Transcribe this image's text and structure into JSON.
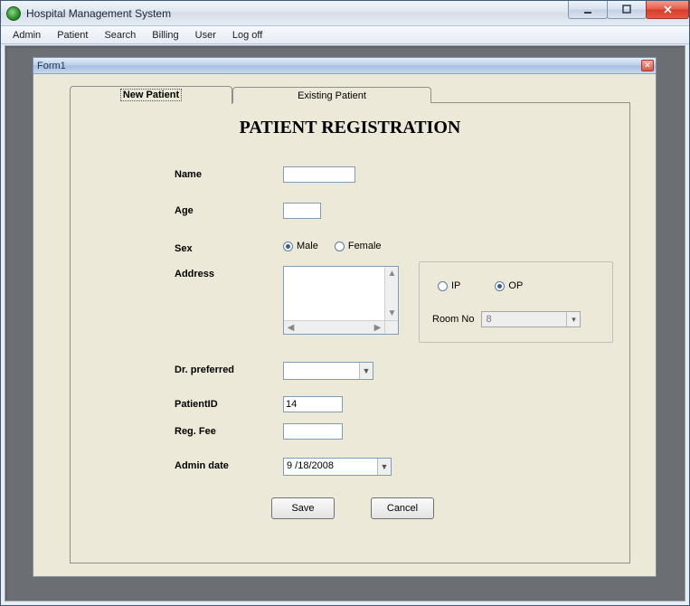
{
  "window": {
    "title": "Hospital Management System"
  },
  "menubar": {
    "items": [
      "Admin",
      "Patient",
      "Search",
      "Billing",
      "User",
      "Log off"
    ]
  },
  "child": {
    "title": "Form1"
  },
  "tabs": {
    "active": "New Patient",
    "inactive": "Existing Patient"
  },
  "panel": {
    "title": "PATIENT REGISTRATION"
  },
  "form": {
    "name_label": "Name",
    "name_value": "",
    "age_label": "Age",
    "age_value": "",
    "sex_label": "Sex",
    "sex_male": "Male",
    "sex_female": "Female",
    "sex_value": "Male",
    "address_label": "Address",
    "address_value": "",
    "dr_label": "Dr. preferred",
    "dr_value": "",
    "patientid_label": "PatientID",
    "patientid_value": "14",
    "regfee_label": "Reg. Fee",
    "regfee_value": "",
    "admindate_label": "Admin date",
    "admindate_value": " 9 /18/2008"
  },
  "group": {
    "ip_label": "IP",
    "op_label": "OP",
    "type_value": "OP",
    "room_label": "Room No",
    "room_value": "8"
  },
  "buttons": {
    "save": "Save",
    "cancel": "Cancel"
  }
}
